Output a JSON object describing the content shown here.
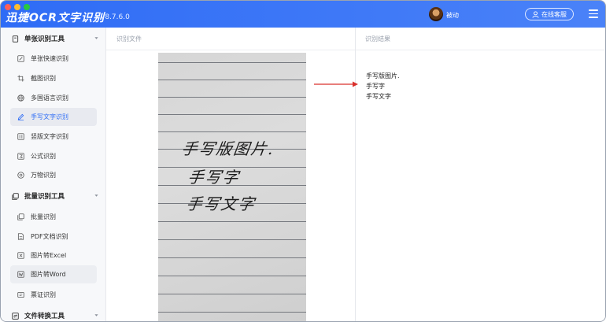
{
  "app": {
    "title": "迅捷OCR文字识别",
    "version": "v8.7.6.0",
    "user_name": "被动",
    "support_label": "在线客服",
    "colors": {
      "accent": "#2d6cf6",
      "titlebar": "#3a75f7",
      "arrow": "#d9302c"
    }
  },
  "sidebar": {
    "groups": [
      {
        "label": "单张识别工具",
        "icon": "document-icon",
        "items": [
          {
            "label": "单张快速识别",
            "icon": "edit-image-icon"
          },
          {
            "label": "截图识别",
            "icon": "crop-icon"
          },
          {
            "label": "多国语言识别",
            "icon": "globe-icon"
          },
          {
            "label": "手写文字识别",
            "icon": "pen-icon",
            "active": true
          },
          {
            "label": "竖版文字识别",
            "icon": "vertical-text-icon"
          },
          {
            "label": "公式识别",
            "icon": "formula-icon"
          },
          {
            "label": "万物识别",
            "icon": "object-icon"
          }
        ]
      },
      {
        "label": "批量识别工具",
        "icon": "batch-icon",
        "items": [
          {
            "label": "批量识别",
            "icon": "stack-icon"
          },
          {
            "label": "PDF文档识别",
            "icon": "pdf-icon"
          },
          {
            "label": "图片转Excel",
            "icon": "excel-icon"
          },
          {
            "label": "图片转Word",
            "icon": "word-icon",
            "hover": true
          },
          {
            "label": "票证识别",
            "icon": "ticket-icon"
          }
        ]
      },
      {
        "label": "文件转换工具",
        "icon": "convert-icon",
        "items": []
      }
    ]
  },
  "main": {
    "left_header": "识别文件",
    "right_header": "识别结果",
    "image_text_lines": [
      "手写版图片.",
      "手写字",
      "手写文字"
    ],
    "result_lines": [
      "手写版图片.",
      "手写字",
      "手写文字"
    ]
  }
}
